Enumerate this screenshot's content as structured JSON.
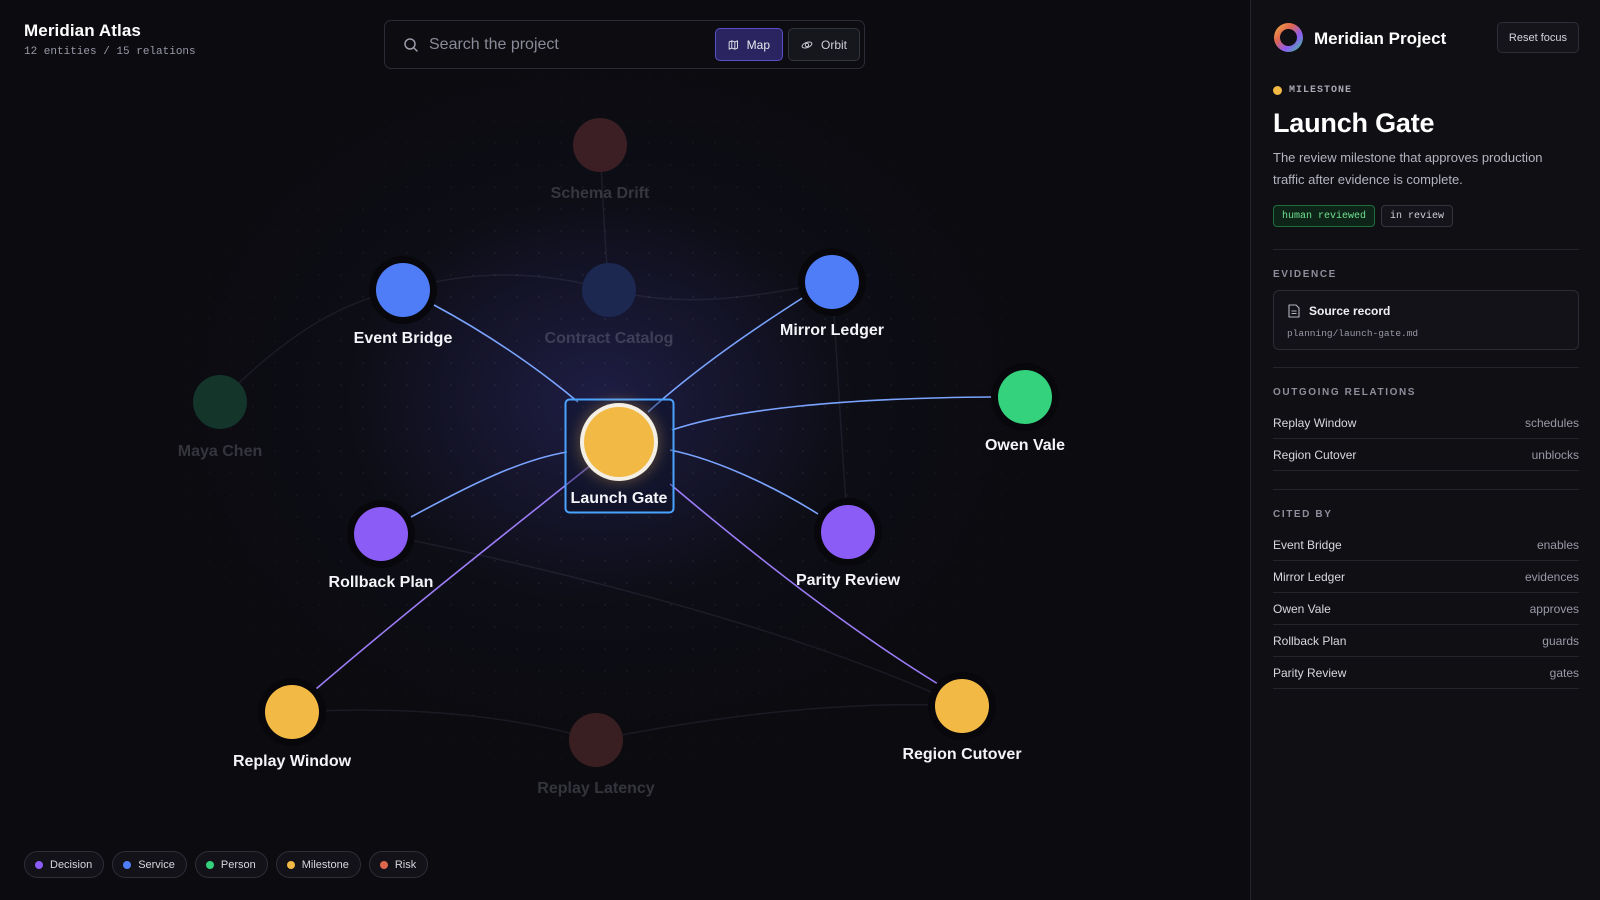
{
  "app": {
    "title": "Meridian Atlas",
    "subtitle": "12 entities / 15 relations"
  },
  "search": {
    "placeholder": "Search the project",
    "value": "",
    "icon": "search-icon"
  },
  "view_modes": [
    {
      "label": "Map",
      "icon": "map-icon",
      "active": true
    },
    {
      "label": "Orbit",
      "icon": "orbit-icon",
      "active": false
    }
  ],
  "colors": {
    "decision": "#8b5cf6",
    "service": "#4f7df8",
    "person": "#34d27d",
    "milestone": "#f2b944",
    "risk": "#e0654d",
    "accent": "#5a4fc8",
    "selection": "#4aa3ff"
  },
  "legend": [
    {
      "label": "Decision",
      "type": "decision"
    },
    {
      "label": "Service",
      "type": "service"
    },
    {
      "label": "Person",
      "type": "person"
    },
    {
      "label": "Milestone",
      "type": "milestone"
    },
    {
      "label": "Risk",
      "type": "risk"
    }
  ],
  "graph": {
    "selected": "Launch Gate",
    "nodes": [
      {
        "id": "schema-drift",
        "label": "Schema Drift",
        "type": "risk",
        "dimmed": true
      },
      {
        "id": "event-bridge",
        "label": "Event Bridge",
        "type": "service",
        "dimmed": false
      },
      {
        "id": "contract-catalog",
        "label": "Contract Catalog",
        "type": "service",
        "dimmed": true
      },
      {
        "id": "mirror-ledger",
        "label": "Mirror Ledger",
        "type": "service",
        "dimmed": false
      },
      {
        "id": "maya-chen",
        "label": "Maya Chen",
        "type": "person",
        "dimmed": true
      },
      {
        "id": "owen-vale",
        "label": "Owen Vale",
        "type": "person",
        "dimmed": false
      },
      {
        "id": "launch-gate",
        "label": "Launch Gate",
        "type": "milestone",
        "dimmed": false
      },
      {
        "id": "rollback-plan",
        "label": "Rollback Plan",
        "type": "decision",
        "dimmed": false
      },
      {
        "id": "parity-review",
        "label": "Parity Review",
        "type": "decision",
        "dimmed": false
      },
      {
        "id": "replay-window",
        "label": "Replay Window",
        "type": "milestone",
        "dimmed": false
      },
      {
        "id": "replay-latency",
        "label": "Replay Latency",
        "type": "risk",
        "dimmed": true
      },
      {
        "id": "region-cutover",
        "label": "Region Cutover",
        "type": "milestone",
        "dimmed": false
      }
    ]
  },
  "panel": {
    "project_name": "Meridian Project",
    "reset_label": "Reset focus",
    "entity_type": "MILESTONE",
    "entity_name": "Launch Gate",
    "entity_description": "The review milestone that approves production traffic after evidence is complete.",
    "tags": [
      "human reviewed",
      "in review"
    ],
    "evidence_heading": "EVIDENCE",
    "evidence": {
      "title": "Source record",
      "path": "planning/launch-gate.md"
    },
    "outgoing_heading": "OUTGOING RELATIONS",
    "outgoing": [
      {
        "name": "Replay Window",
        "relation": "schedules"
      },
      {
        "name": "Region Cutover",
        "relation": "unblocks"
      }
    ],
    "cited_heading": "CITED BY",
    "cited_by": [
      {
        "name": "Event Bridge",
        "relation": "enables"
      },
      {
        "name": "Mirror Ledger",
        "relation": "evidences"
      },
      {
        "name": "Owen Vale",
        "relation": "approves"
      },
      {
        "name": "Rollback Plan",
        "relation": "guards"
      },
      {
        "name": "Parity Review",
        "relation": "gates"
      }
    ]
  }
}
